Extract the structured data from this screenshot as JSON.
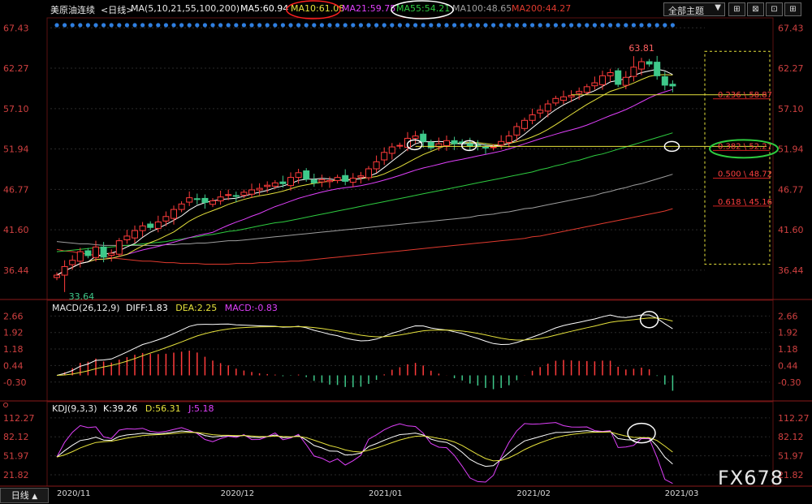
{
  "header": {
    "instrument": "美原油连续",
    "period_tag": "<日线>",
    "ma_params": "MA(5,10,21,55,100,200)",
    "ma5": "MA5:60.94",
    "ma10": "MA10:61.08",
    "ma21": "MA21:59.75",
    "ma55": "MA55:54.21",
    "ma100": "MA100:48.65",
    "ma200": "MA200:44.27",
    "dropdown_label": "全部主题",
    "dropdown_icon": "chevron-down-icon",
    "buttons": [
      {
        "name": "grid-view-button",
        "glyph": "⊞"
      },
      {
        "name": "expand-button",
        "glyph": "⊠"
      },
      {
        "name": "zoom-button",
        "glyph": "⊡"
      },
      {
        "name": "add-indicator-button",
        "glyph": "⊞"
      }
    ]
  },
  "colors": {
    "up": "#ff3b3b",
    "down": "#3ec98a",
    "ma5": "#ffffff",
    "ma10": "#e6e23c",
    "ma21": "#e040fb",
    "ma55": "#2ecc40",
    "ma100": "#9e9e9e",
    "ma200": "#e03a2e",
    "axis_text": "#d04040",
    "grid": "#2a2a2a"
  },
  "chart_data": [
    {
      "type": "candlestick",
      "panel": "price",
      "ylim": [
        33.0,
        68.5
      ],
      "y_ticks": [
        "67.43",
        "62.27",
        "57.10",
        "51.94",
        "46.77",
        "41.60",
        "36.44"
      ],
      "x_labels": [
        "2020/11",
        "2020/12",
        "2021/01",
        "2021/02",
        "2021/03"
      ],
      "x_label_index": [
        0,
        21,
        40,
        59,
        78
      ],
      "bar_count": 80,
      "closes": [
        35.8,
        36.9,
        37.7,
        38.8,
        38.3,
        39.4,
        38.1,
        38.6,
        40.2,
        40.8,
        41.5,
        42.1,
        41.9,
        42.6,
        43.3,
        44.2,
        44.9,
        45.7,
        45.5,
        45.1,
        45.3,
        45.8,
        46.1,
        45.9,
        46.4,
        46.7,
        46.9,
        47.3,
        47.6,
        47.5,
        48.3,
        48.9,
        48.1,
        47.6,
        48.0,
        47.9,
        48.3,
        47.8,
        48.2,
        48.5,
        49.4,
        50.3,
        51.5,
        52.2,
        52.4,
        53.3,
        53.6,
        52.9,
        52.1,
        52.6,
        53.0,
        52.6,
        52.7,
        52.3,
        52.4,
        52.1,
        52.2,
        52.9,
        53.6,
        54.8,
        55.6,
        56.3,
        56.9,
        57.7,
        58.4,
        58.6,
        58.8,
        59.3,
        59.9,
        60.4,
        61.3,
        61.7,
        60.2,
        61.1,
        62.4,
        63.1,
        62.8,
        61.3,
        60.1,
        60.0
      ],
      "low_annotation": {
        "value": 33.64,
        "label": "33.64",
        "index": 1
      },
      "high_annotation": {
        "value": 63.81,
        "label": "63.81",
        "index": 74
      },
      "fibonacci": [
        {
          "ratio": "0.236",
          "price": 58.87,
          "label": "0.236 \\ 58.87"
        },
        {
          "ratio": "0.382",
          "price": 52.27,
          "label": "0.382 \\ 52.27"
        },
        {
          "ratio": "0.500",
          "price": 48.72,
          "label": "0.500 \\ 48.72"
        },
        {
          "ratio": "0.618",
          "price": 45.16,
          "label": "0.618 \\ 45.16"
        }
      ],
      "series": [
        {
          "name": "MA5",
          "color": "#ffffff"
        },
        {
          "name": "MA10",
          "color": "#e6e23c"
        },
        {
          "name": "MA21",
          "color": "#e040fb"
        },
        {
          "name": "MA55",
          "color": "#2ecc40",
          "values_approx": [
            38.8,
            38.9,
            39.0,
            39.1,
            39.2,
            39.3,
            39.3,
            39.4,
            39.5,
            39.6,
            39.7,
            39.8,
            39.9,
            40.0,
            40.1,
            40.3,
            40.4,
            40.6,
            40.7,
            40.9,
            41.0,
            41.2,
            41.4,
            41.5,
            41.7,
            41.9,
            42.1,
            42.3,
            42.5,
            42.6,
            42.8,
            43.0,
            43.2,
            43.4,
            43.6,
            43.8,
            44.0,
            44.2,
            44.4,
            44.6,
            44.8,
            45.0,
            45.2,
            45.4,
            45.6,
            45.8,
            46.0,
            46.2,
            46.4,
            46.6,
            46.8,
            47.0,
            47.2,
            47.4,
            47.6,
            47.8,
            48.0,
            48.2,
            48.4,
            48.6,
            48.8,
            49.0,
            49.3,
            49.5,
            49.8,
            50.0,
            50.3,
            50.5,
            50.8,
            51.1,
            51.3,
            51.6,
            51.9,
            52.2,
            52.5,
            52.8,
            53.1,
            53.4,
            53.7,
            54.0
          ]
        },
        {
          "name": "MA100",
          "color": "#9e9e9e",
          "values_approx": [
            40.1,
            40.0,
            39.9,
            39.8,
            39.8,
            39.7,
            39.6,
            39.6,
            39.6,
            39.6,
            39.6,
            39.6,
            39.6,
            39.6,
            39.7,
            39.7,
            39.8,
            39.8,
            39.9,
            39.9,
            40.0,
            40.1,
            40.2,
            40.2,
            40.3,
            40.4,
            40.5,
            40.6,
            40.7,
            40.8,
            40.9,
            41.0,
            41.1,
            41.2,
            41.3,
            41.4,
            41.5,
            41.6,
            41.7,
            41.8,
            41.9,
            42.0,
            42.1,
            42.2,
            42.3,
            42.4,
            42.5,
            42.6,
            42.7,
            42.8,
            42.9,
            43.0,
            43.1,
            43.2,
            43.4,
            43.5,
            43.6,
            43.8,
            43.9,
            44.1,
            44.3,
            44.4,
            44.6,
            44.8,
            45.0,
            45.2,
            45.4,
            45.6,
            45.8,
            46.0,
            46.3,
            46.5,
            46.8,
            47.0,
            47.3,
            47.5,
            47.8,
            48.1,
            48.4,
            48.7
          ]
        },
        {
          "name": "MA200",
          "color": "#e03a2e",
          "values_approx": [
            39.1,
            38.9,
            38.8,
            38.6,
            38.5,
            38.3,
            38.2,
            38.0,
            37.9,
            37.8,
            37.7,
            37.6,
            37.6,
            37.5,
            37.4,
            37.4,
            37.3,
            37.3,
            37.3,
            37.2,
            37.2,
            37.2,
            37.2,
            37.3,
            37.3,
            37.3,
            37.4,
            37.4,
            37.5,
            37.5,
            37.6,
            37.6,
            37.7,
            37.8,
            37.9,
            38.0,
            38.1,
            38.2,
            38.3,
            38.4,
            38.5,
            38.6,
            38.7,
            38.8,
            38.9,
            39.0,
            39.1,
            39.2,
            39.3,
            39.4,
            39.5,
            39.6,
            39.7,
            39.8,
            39.9,
            40.0,
            40.1,
            40.2,
            40.3,
            40.4,
            40.5,
            40.7,
            40.8,
            41.0,
            41.2,
            41.4,
            41.6,
            41.8,
            42.0,
            42.2,
            42.4,
            42.6,
            42.8,
            43.0,
            43.2,
            43.4,
            43.6,
            43.8,
            44.0,
            44.3
          ]
        }
      ]
    },
    {
      "type": "line",
      "panel": "macd",
      "header": "MACD(26,12,9)",
      "diff_label": "DIFF:1.83",
      "dea_label": "DEA:2.25",
      "macd_label": "MACD:-0.83",
      "ylim": [
        -1.0,
        3.0
      ],
      "y_ticks": [
        "2.66",
        "1.92",
        "1.18",
        "0.44",
        "-0.30"
      ],
      "series": [
        {
          "name": "DIFF",
          "color": "#ffffff"
        },
        {
          "name": "DEA",
          "color": "#e6e23c"
        }
      ]
    },
    {
      "type": "line",
      "panel": "kdj",
      "header": "KDJ(9,3,3)",
      "k_label": "K:39.26",
      "d_label": "D:56.31",
      "j_label": "J:5.18",
      "ylim": [
        5,
        125
      ],
      "y_ticks": [
        "112.27",
        "82.12",
        "51.97",
        "21.82"
      ],
      "series": [
        {
          "name": "K",
          "color": "#ffffff"
        },
        {
          "name": "D",
          "color": "#e6e23c"
        },
        {
          "name": "J",
          "color": "#e040fb"
        }
      ]
    }
  ],
  "footer": {
    "period_button": "日线",
    "period_icon": "triangle-up-icon",
    "watermark": "FX678"
  }
}
